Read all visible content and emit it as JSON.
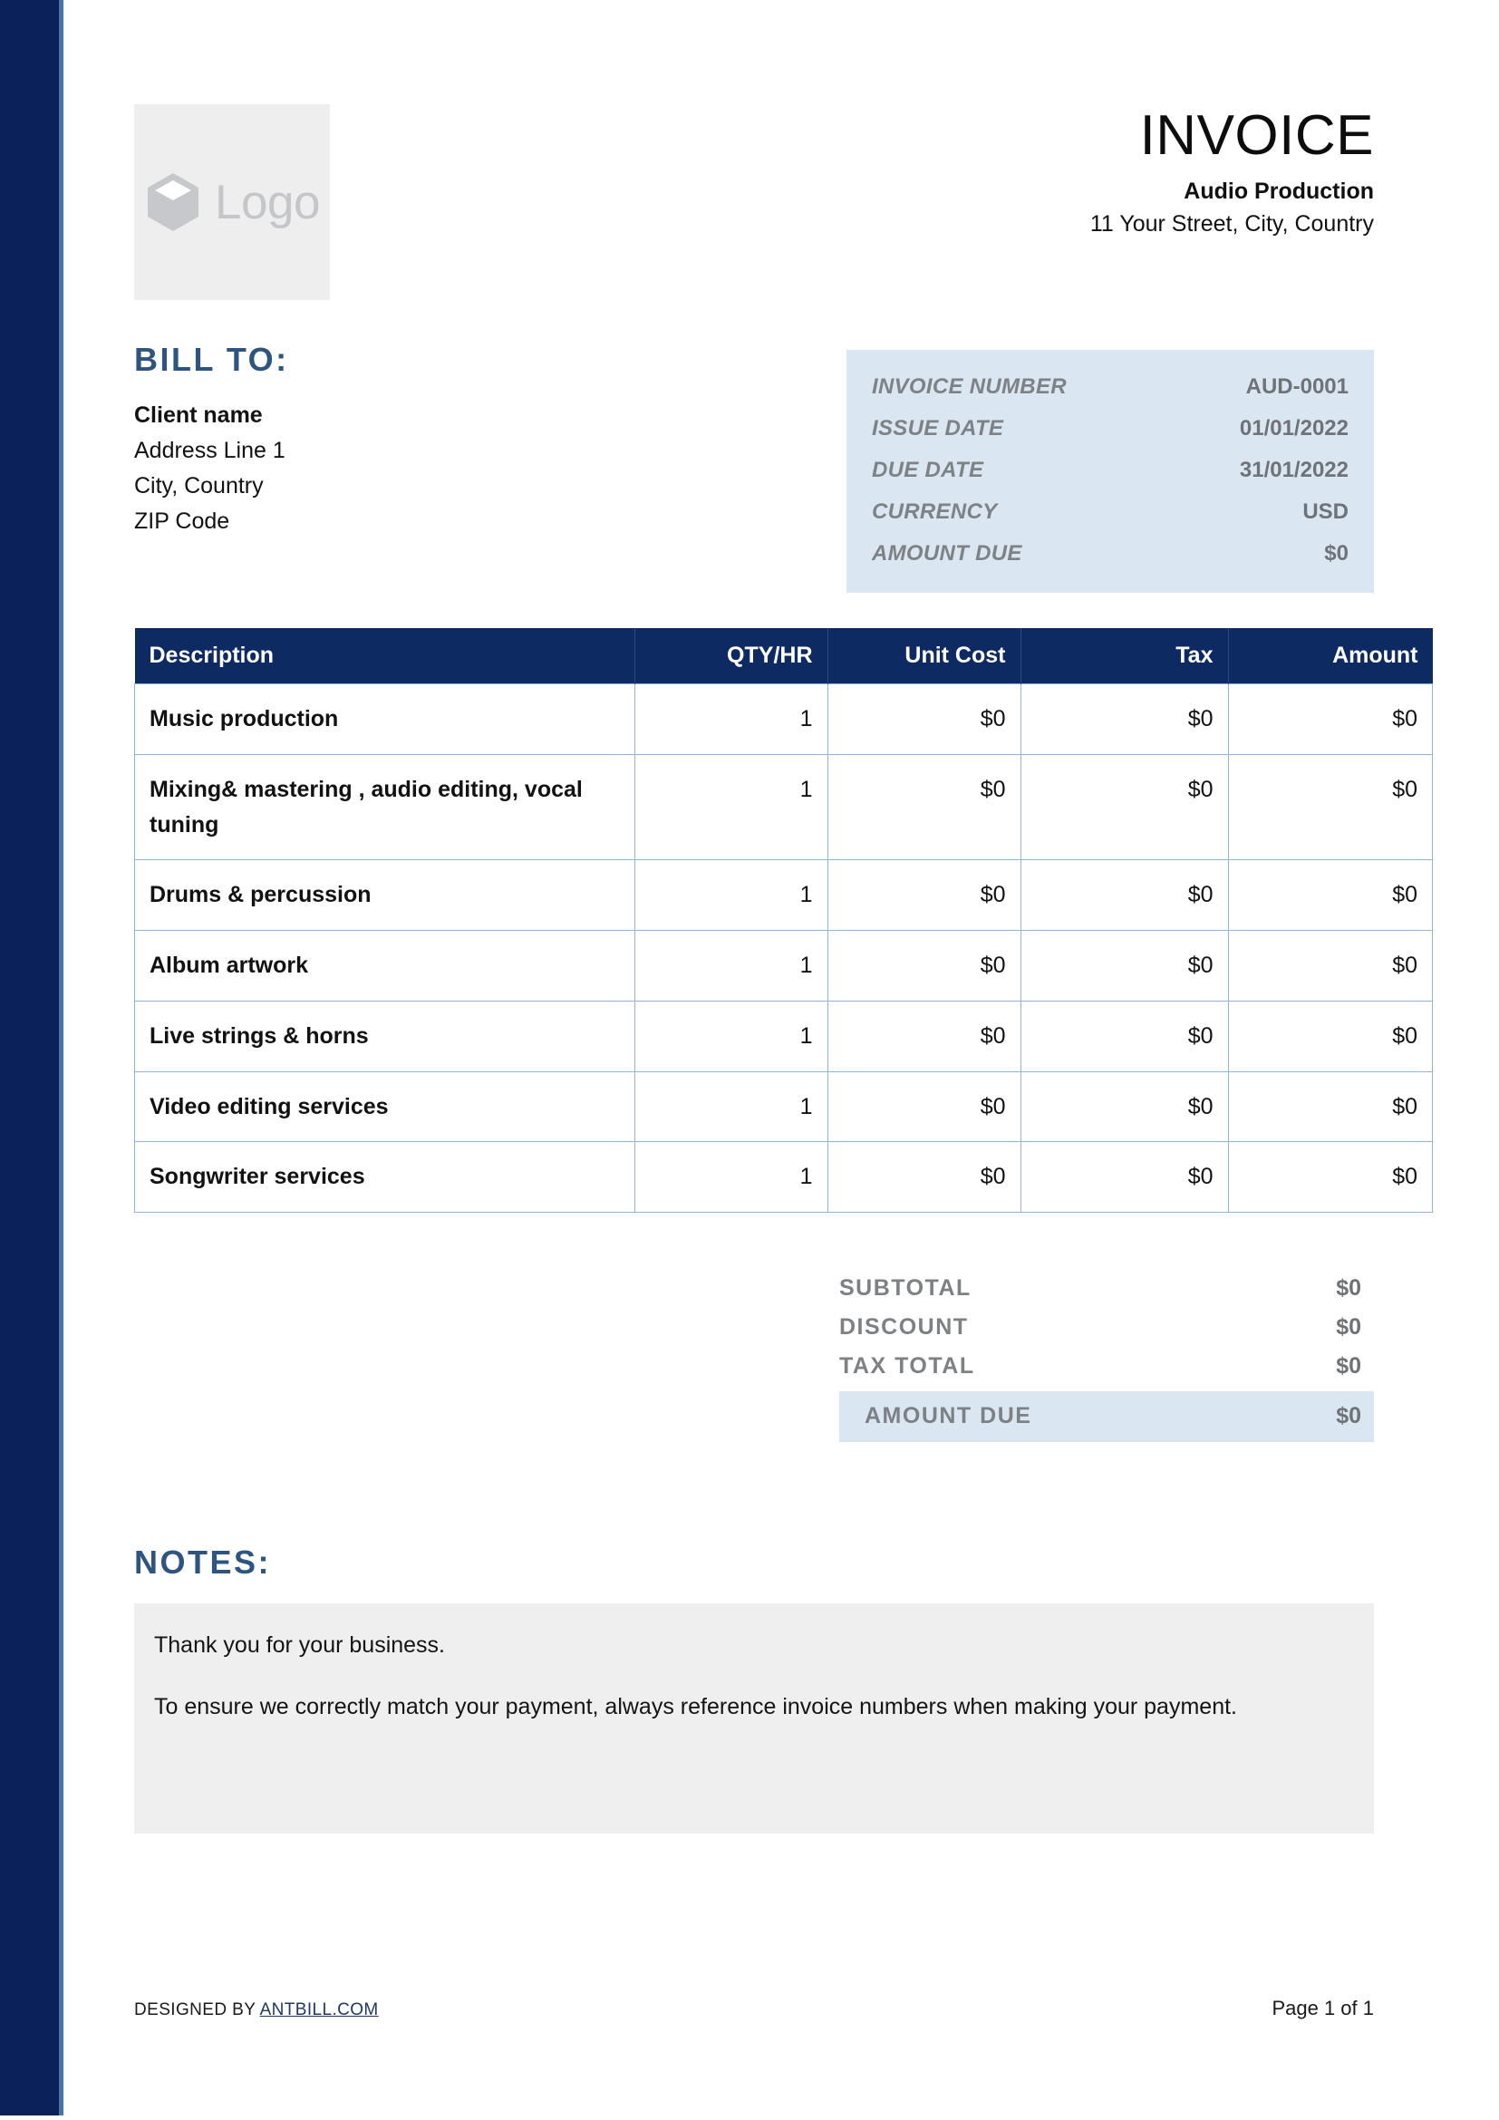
{
  "document": {
    "title": "INVOICE"
  },
  "theme": {
    "stripe_navy": "#0a2159",
    "stripe_edge": "#4a74a5",
    "heading_blue": "#2d5580",
    "table_header_navy": "#0e2a63",
    "table_border_blue": "#8fb5dd",
    "meta_panel_blue": "#dbe6f3",
    "notes_panel_gray": "#efefef",
    "logo_panel_gray": "#eeeeee"
  },
  "header": {
    "logo_text": "Logo",
    "logo_icon": "cube-icon",
    "title": "INVOICE",
    "company_name": "Audio Production",
    "company_address": "11 Your Street, City, Country"
  },
  "bill_to": {
    "heading": "BILL TO:",
    "client_name": "Client name",
    "address_line_1": "Address Line 1",
    "city_country": "City, Country",
    "zip_code": "ZIP Code"
  },
  "meta": {
    "rows": [
      {
        "label": "INVOICE NUMBER",
        "value": "AUD-0001"
      },
      {
        "label": "ISSUE DATE",
        "value": "01/01/2022"
      },
      {
        "label": "DUE DATE",
        "value": "31/01/2022"
      },
      {
        "label": "CURRENCY",
        "value": "USD"
      },
      {
        "label": "AMOUNT DUE",
        "value": "$0"
      }
    ]
  },
  "items_table": {
    "columns": [
      "Description",
      "QTY/HR",
      "Unit Cost",
      "Tax",
      "Amount"
    ],
    "rows": [
      {
        "description": "Music production",
        "qty": "1",
        "unit_cost": "$0",
        "tax": "$0",
        "amount": "$0"
      },
      {
        "description": "Mixing& mastering , audio editing, vocal tuning",
        "qty": "1",
        "unit_cost": "$0",
        "tax": "$0",
        "amount": "$0"
      },
      {
        "description": "Drums & percussion",
        "qty": "1",
        "unit_cost": "$0",
        "tax": "$0",
        "amount": "$0"
      },
      {
        "description": "Album artwork",
        "qty": "1",
        "unit_cost": "$0",
        "tax": "$0",
        "amount": "$0"
      },
      {
        "description": "Live strings & horns",
        "qty": "1",
        "unit_cost": "$0",
        "tax": "$0",
        "amount": "$0"
      },
      {
        "description": "Video editing services",
        "qty": "1",
        "unit_cost": "$0",
        "tax": "$0",
        "amount": "$0"
      },
      {
        "description": "Songwriter services",
        "qty": "1",
        "unit_cost": "$0",
        "tax": "$0",
        "amount": "$0"
      }
    ]
  },
  "totals": {
    "rows": [
      {
        "label": "SUBTOTAL",
        "value": "$0"
      },
      {
        "label": "DISCOUNT",
        "value": "$0"
      },
      {
        "label": "TAX TOTAL",
        "value": "$0"
      }
    ],
    "amount_due": {
      "label": "AMOUNT DUE",
      "value": "$0"
    }
  },
  "notes": {
    "heading": "NOTES:",
    "lines": [
      "Thank you for your business.",
      "To ensure we correctly match your payment, always reference invoice numbers when making your payment."
    ]
  },
  "footer": {
    "designed_prefix": "DESIGNED BY ",
    "designed_link": "ANTBILL.COM",
    "page_number": "Page 1 of 1"
  }
}
